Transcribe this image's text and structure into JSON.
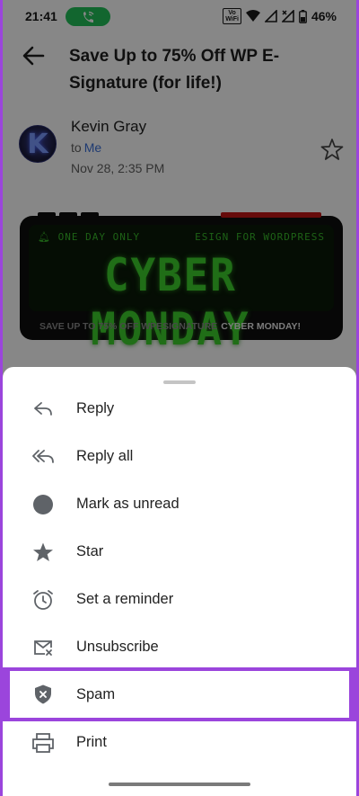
{
  "status_bar": {
    "time": "21:41",
    "battery": "46%",
    "volte_line1": "Vo",
    "volte_line2": "WiFi"
  },
  "email": {
    "subject": "Save Up to 75% Off WP E-Signature (for life!)",
    "sender": "Kevin Gray",
    "to_prefix": "to",
    "to_recipient": "Me",
    "date": "Nov 28, 2:35 PM",
    "avatar_letter": "K"
  },
  "banner": {
    "top_left": "ONE DAY ONLY",
    "top_right": "ESIGN FOR WORDPRESS",
    "headline": "CYBER MONDAY",
    "bottom_text": "SAVE UP TO 75% OFF WPESIGNATURE",
    "bottom_highlight": "CYBER MONDAY!"
  },
  "menu": {
    "items": [
      {
        "label": "Reply",
        "icon": "reply-icon"
      },
      {
        "label": "Reply all",
        "icon": "reply-all-icon"
      },
      {
        "label": "Mark as unread",
        "icon": "circle-icon"
      },
      {
        "label": "Star",
        "icon": "star-filled-icon"
      },
      {
        "label": "Set a reminder",
        "icon": "alarm-icon"
      },
      {
        "label": "Unsubscribe",
        "icon": "unsubscribe-icon"
      },
      {
        "label": "Spam",
        "icon": "spam-shield-icon"
      },
      {
        "label": "Print",
        "icon": "print-icon"
      }
    ]
  },
  "colors": {
    "highlight": "#9b45dc",
    "call_pill": "#22c15a",
    "link": "#3a6fd8",
    "icon_gray": "#5f6368"
  }
}
